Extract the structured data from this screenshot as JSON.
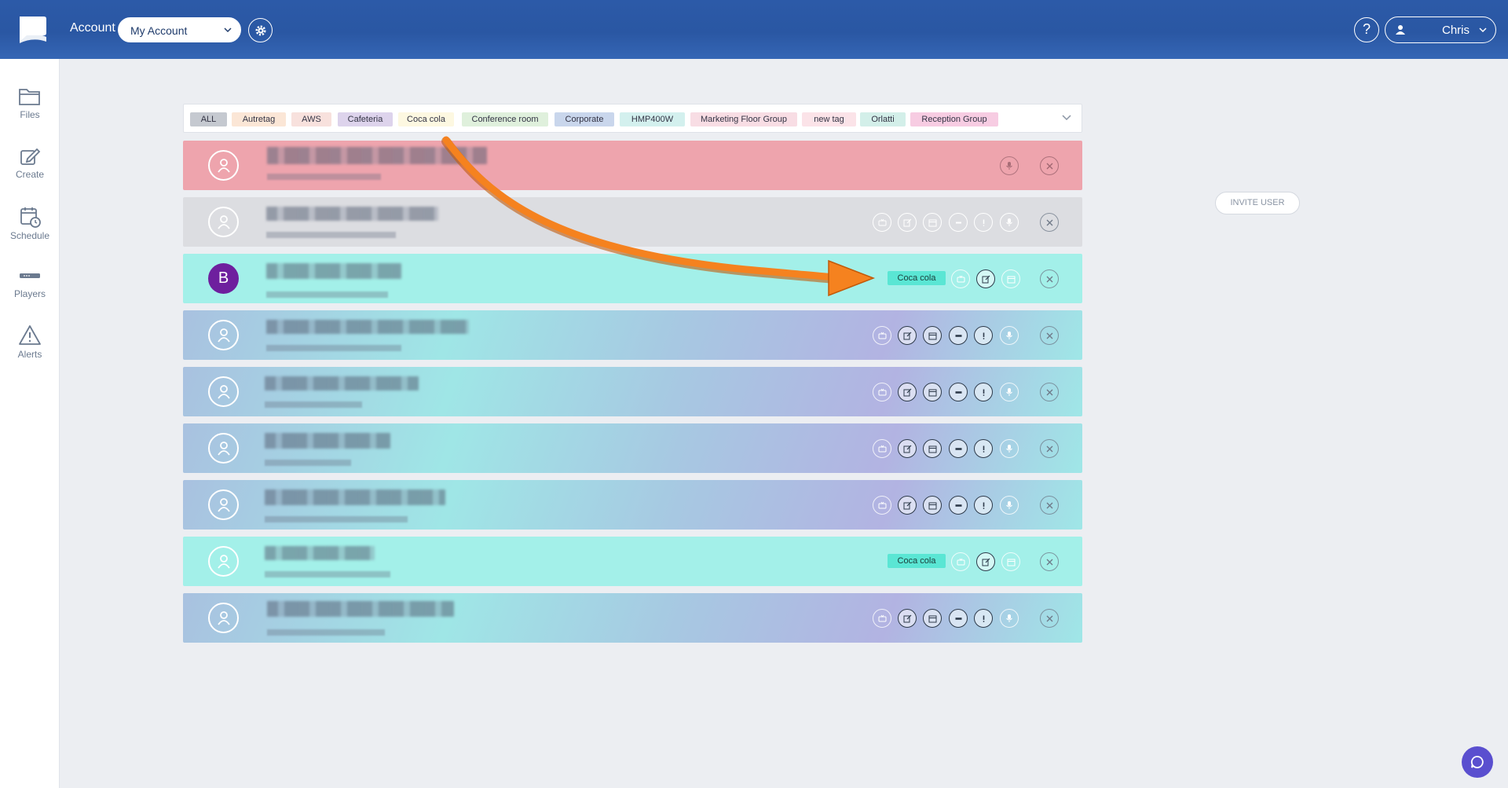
{
  "header": {
    "account_label": "Account",
    "account_select": "My Account",
    "help_label": "?",
    "user_name": "Chris"
  },
  "sidebar": {
    "items": [
      {
        "label": "Files",
        "icon": "folder-icon"
      },
      {
        "label": "Create",
        "icon": "edit-icon"
      },
      {
        "label": "Schedule",
        "icon": "calendar-clock-icon"
      },
      {
        "label": "Players",
        "icon": "player-device-icon"
      },
      {
        "label": "Alerts",
        "icon": "warning-icon"
      }
    ]
  },
  "tags": [
    {
      "label": "ALL",
      "color": "#c5c9d0"
    },
    {
      "label": "Autretag",
      "color": "#fbe6d6"
    },
    {
      "label": "AWS",
      "color": "#f8e1dd"
    },
    {
      "label": "Cafeteria",
      "color": "#ddd3ec"
    },
    {
      "label": "Coca cola",
      "color": "#fdf8e1"
    },
    {
      "label": "Conference room",
      "color": "#dff0dc"
    },
    {
      "label": "Corporate",
      "color": "#c9d6ec"
    },
    {
      "label": "HMP400W",
      "color": "#d3f0ee"
    },
    {
      "label": "Marketing Floor Group",
      "color": "#f8dde4"
    },
    {
      "label": "new tag",
      "color": "#fbe3e8"
    },
    {
      "label": "Orlatti",
      "color": "#d3efe9"
    },
    {
      "label": "Reception Group",
      "color": "#f7cce2"
    }
  ],
  "users": [
    {
      "style": "pink",
      "avatar": "user-icon",
      "badge": "",
      "actions": "mic-only"
    },
    {
      "style": "grey",
      "avatar": "user-icon",
      "badge": "",
      "actions": "all-off"
    },
    {
      "style": "mint",
      "avatar_letter": "B",
      "badge": "Coca cola",
      "actions": "partial"
    },
    {
      "style": "gradient",
      "avatar": "user-icon",
      "badge": "",
      "actions": "full"
    },
    {
      "style": "gradient",
      "avatar": "user-icon",
      "badge": "",
      "actions": "full"
    },
    {
      "style": "gradient",
      "avatar": "user-icon",
      "badge": "",
      "actions": "full"
    },
    {
      "style": "gradient",
      "avatar": "user-icon",
      "badge": "",
      "actions": "full"
    },
    {
      "style": "mint",
      "avatar": "user-icon",
      "badge": "Coca cola",
      "actions": "partial"
    },
    {
      "style": "gradient",
      "avatar": "user-icon",
      "badge": "",
      "actions": "full"
    }
  ],
  "invite_label": "INVITE USER",
  "colors": {
    "header": "#2c5aa8",
    "row_pink": "#eea4ad",
    "row_grey": "#dcdde1",
    "row_mint": "#a3f0e9",
    "badge": "#5ae6d4",
    "avatar_b": "#6e1f9e",
    "arrow": "#f5821f",
    "chat": "#5a4fcf"
  }
}
